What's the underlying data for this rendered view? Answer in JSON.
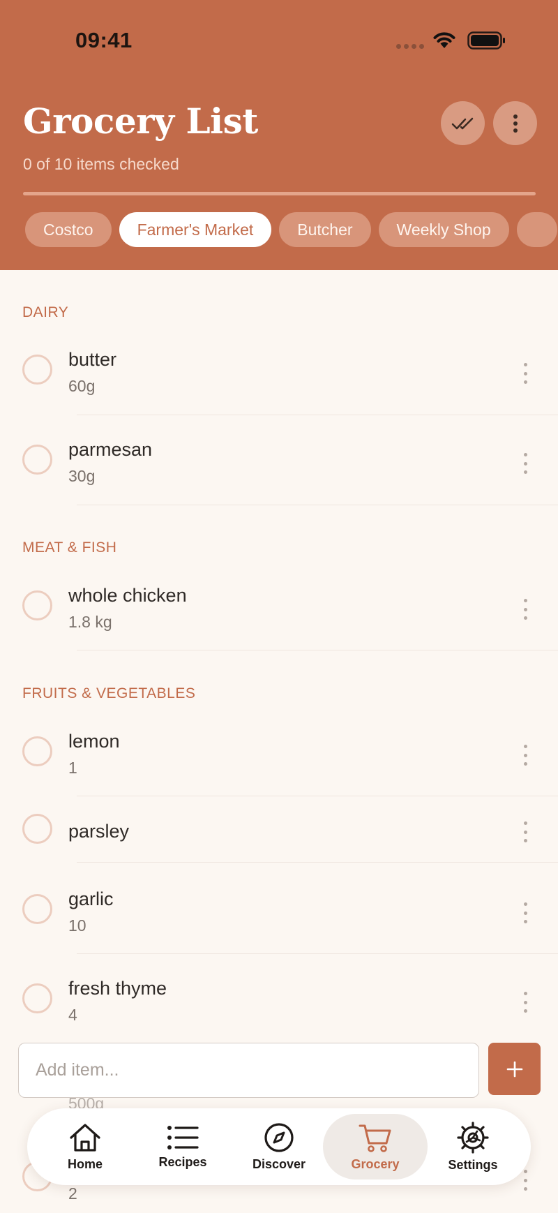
{
  "status_bar": {
    "time": "09:41"
  },
  "header": {
    "title": "Grocery List",
    "subtitle": "0 of 10 items checked",
    "progress_checked": 0,
    "progress_total": 10
  },
  "stores": [
    {
      "label": "Costco",
      "active": false
    },
    {
      "label": "Farmer's Market",
      "active": true
    },
    {
      "label": "Butcher",
      "active": false
    },
    {
      "label": "Weekly Shop",
      "active": false
    }
  ],
  "sections": [
    {
      "label": "DAIRY",
      "items": [
        {
          "name": "butter",
          "quantity": "60g",
          "checked": false
        },
        {
          "name": "parmesan",
          "quantity": "30g",
          "checked": false
        }
      ]
    },
    {
      "label": "MEAT & FISH",
      "items": [
        {
          "name": "whole chicken",
          "quantity": "1.8 kg",
          "checked": false
        }
      ]
    },
    {
      "label": "FRUITS & VEGETABLES",
      "items": [
        {
          "name": "lemon",
          "quantity": "1",
          "checked": false
        },
        {
          "name": "parsley",
          "quantity": "",
          "checked": false
        },
        {
          "name": "garlic",
          "quantity": "10",
          "checked": false
        },
        {
          "name": "fresh thyme",
          "quantity": "4",
          "checked": false
        }
      ]
    }
  ],
  "partially_hidden": {
    "item_quantity": "500g",
    "last_item_quantity": "2"
  },
  "add_item": {
    "placeholder": "Add item...",
    "value": ""
  },
  "tabs": [
    {
      "label": "Home",
      "icon": "home-icon",
      "active": false
    },
    {
      "label": "Recipes",
      "icon": "list-icon",
      "active": false
    },
    {
      "label": "Discover",
      "icon": "compass-icon",
      "active": false
    },
    {
      "label": "Grocery",
      "icon": "cart-icon",
      "active": true
    },
    {
      "label": "Settings",
      "icon": "gear-icon",
      "active": false
    }
  ],
  "colors": {
    "accent": "#c26b4a",
    "background": "#fcf7f2",
    "section_label": "#c26b4a",
    "checkbox_border": "#eccdbf"
  }
}
